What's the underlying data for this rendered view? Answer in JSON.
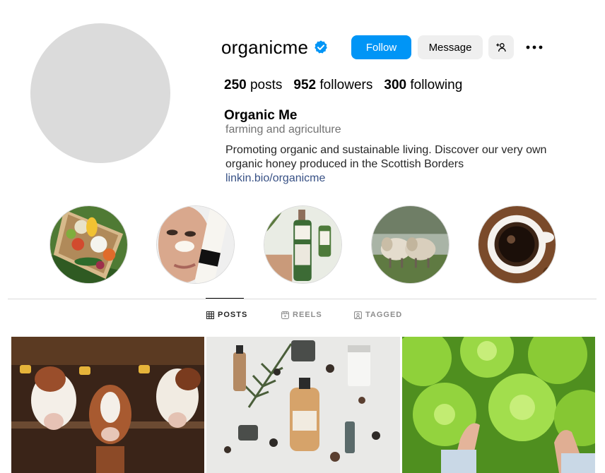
{
  "profile": {
    "username": "organicme",
    "follow_label": "Follow",
    "message_label": "Message",
    "stats": {
      "posts_count": "250",
      "posts_label": "posts",
      "followers_count": "952",
      "followers_label": "followers",
      "following_count": "300",
      "following_label": "following"
    },
    "full_name": "Organic Me",
    "category": "farming and agriculture",
    "bio": "Promoting organic and sustainable living. Discover our very own organic honey produced in the Scottish Borders",
    "link": "linkin.bio/organicme"
  },
  "highlights": [
    {
      "icon": "vegetable-crate"
    },
    {
      "icon": "face-mask"
    },
    {
      "icon": "green-bottles"
    },
    {
      "icon": "sheep"
    },
    {
      "icon": "coffee-cup"
    }
  ],
  "tabs": [
    {
      "label": "POSTS",
      "icon": "grid-icon",
      "active": true
    },
    {
      "label": "REELS",
      "icon": "reels-icon",
      "active": false
    },
    {
      "label": "TAGGED",
      "icon": "tagged-icon",
      "active": false
    }
  ],
  "posts": [
    {
      "subject": "cows"
    },
    {
      "subject": "skincare-products"
    },
    {
      "subject": "lettuce"
    }
  ],
  "colors": {
    "accent": "#0095f6",
    "verified": "#0095f6",
    "link": "#385185",
    "secondary_text": "#737373"
  }
}
